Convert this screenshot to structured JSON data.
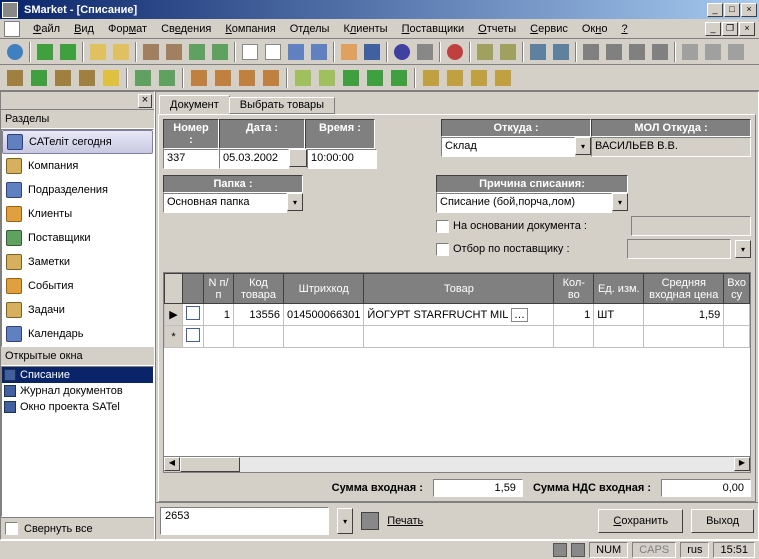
{
  "window": {
    "title": "SMarket - [Списание]"
  },
  "winbtns": {
    "min": "_",
    "max": "□",
    "close": "×"
  },
  "menu": {
    "file": "Файл",
    "view": "Вид",
    "format": "Формат",
    "info": "Сведения",
    "company": "Компания",
    "departments": "Отделы",
    "clients": "Клиенты",
    "suppliers": "Поставщики",
    "reports": "Отчеты",
    "service": "Сервис",
    "window": "Окно",
    "help": "?"
  },
  "sidebar": {
    "sections_label": "Разделы",
    "items": [
      {
        "label": "САТеліт сегодня"
      },
      {
        "label": "Компания"
      },
      {
        "label": "Подразделения"
      },
      {
        "label": "Клиенты"
      },
      {
        "label": "Поставщики"
      },
      {
        "label": "Заметки"
      },
      {
        "label": "События"
      },
      {
        "label": "Задачи"
      },
      {
        "label": "Календарь"
      }
    ],
    "open_windows_label": "Открытые окна",
    "windows": [
      {
        "label": "Списание"
      },
      {
        "label": "Журнал документов"
      },
      {
        "label": "Окно проекта SATel"
      }
    ],
    "collapse": "Свернуть все"
  },
  "tabs": {
    "doc": "Документ",
    "goods": "Выбрать товары"
  },
  "form": {
    "number_hdr": "Номер :",
    "date_hdr": "Дата :",
    "time_hdr": "Время :",
    "number": "337",
    "date": "05.03.2002",
    "time": "10:00:00",
    "folder_hdr": "Папка :",
    "folder": "Основная папка",
    "from_hdr": "Откуда :",
    "from": "Склад",
    "mol_hdr": "МОЛ Откуда :",
    "mol": "ВАСИЛЬЕВ В.В.",
    "reason_hdr": "Причина списания:",
    "reason": "Списание (бой,порча,лом)",
    "by_doc": "На основании документа :",
    "by_supplier": "Отбор по поставщику :"
  },
  "grid": {
    "hdr": {
      "num": "N п/п",
      "code": "Код товара",
      "barcode": "Штрихкод",
      "name": "Товар",
      "qty": "Кол-во",
      "unit": "Ед. изм.",
      "price": "Средняя входная цена",
      "cut": "Вхо су"
    },
    "row": {
      "num": "1",
      "code": "13556",
      "barcode": "014500066301",
      "name": "ЙОГУРТ STARFRUCHT MIL",
      "qty": "1",
      "unit": "ШТ",
      "price": "1,59"
    }
  },
  "sums": {
    "in_label": "Сумма входная :",
    "in_val": "1,59",
    "vat_label": "Сумма НДС входная :",
    "vat_val": "0,00"
  },
  "footer": {
    "code": "2653",
    "print": "Печать",
    "save": "Сохранить",
    "exit": "Выход"
  },
  "status": {
    "num": "NUM",
    "caps": "CAPS",
    "lang": "rus",
    "time": "15:51"
  }
}
